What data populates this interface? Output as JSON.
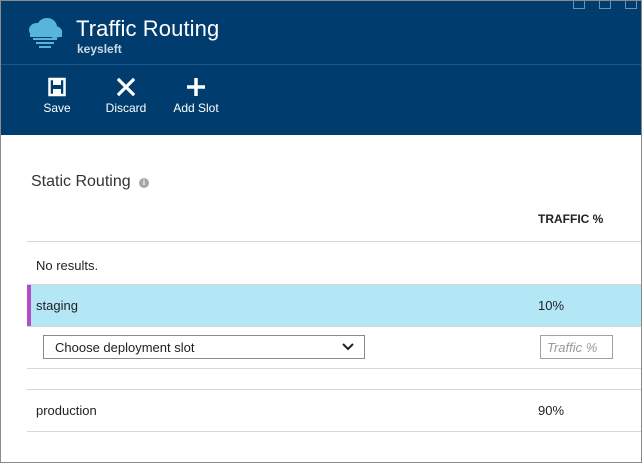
{
  "header": {
    "title": "Traffic Routing",
    "subtitle": "keysleft",
    "app_icon": "cloud-web-app-icon",
    "background_color": "#003d6e"
  },
  "toolbar": {
    "save": {
      "label": "Save",
      "icon": "save-icon"
    },
    "discard": {
      "label": "Discard",
      "icon": "close-icon"
    },
    "add_slot": {
      "label": "Add Slot",
      "icon": "plus-icon"
    }
  },
  "section": {
    "title": "Static Routing",
    "info_icon": "info-icon"
  },
  "table": {
    "column_header": "TRAFFIC %",
    "empty_text": "No results.",
    "rows": [
      {
        "name": "staging",
        "traffic": "10%",
        "selected": true,
        "highlight_color": "#b3e7f6",
        "accent_color": "#b04cc8"
      },
      {
        "name": "production",
        "traffic": "90%",
        "selected": false
      }
    ]
  },
  "new_slot": {
    "select_value": "Choose deployment slot",
    "traffic_placeholder": "Traffic %"
  }
}
